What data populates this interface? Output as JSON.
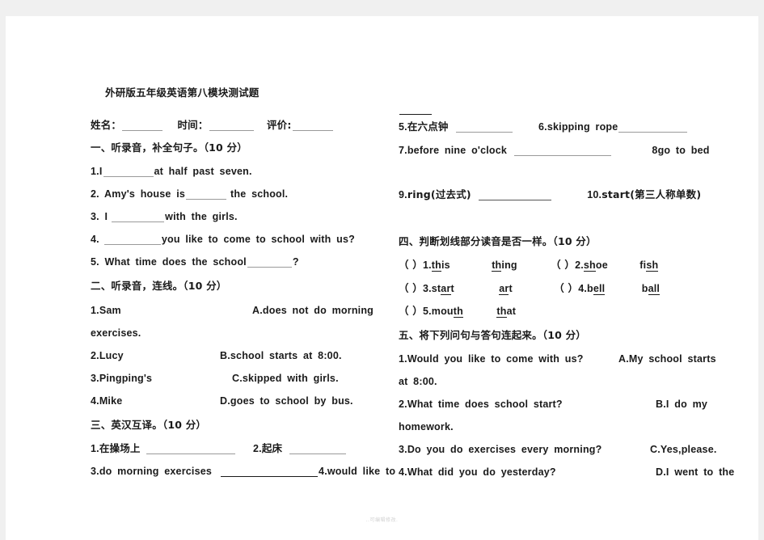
{
  "document": {
    "title": "外研版五年级英语第八模块测试题",
    "footer_note": "..可编辑修改."
  },
  "header": {
    "name_label": "姓名：",
    "time_label": "时间：",
    "score_label": "评价:"
  },
  "sections": {
    "one": {
      "heading": "一、听录音，补全句子。（10 分）",
      "items": [
        {
          "num": "1.I",
          "tail": "at half past seven."
        },
        {
          "num": "2. Amy's house is",
          "tail": "the school."
        },
        {
          "num": "3. I",
          "tail": "with the girls."
        },
        {
          "num": "4.",
          "tail": "you like to come to school with us?"
        },
        {
          "num": "5. What time does the school",
          "tail": "?"
        }
      ]
    },
    "two": {
      "heading": "二、听录音，连线。（10 分）",
      "left_items": [
        "1.Sam",
        "2.Lucy",
        "3.Pingping's",
        "4.Mike"
      ],
      "left_item_1_wrap": "exercises.",
      "right_items": [
        "A.does not do morning",
        "B.school starts at 8:00.",
        "C.skipped with girls.",
        "D.goes to school by bus."
      ]
    },
    "three": {
      "heading": "三、英汉互译。（10 分）",
      "items": [
        {
          "num": "1.",
          "text": "在操场上"
        },
        {
          "num": "2.",
          "text": "起床"
        },
        {
          "num": "3.",
          "text": "do morning exercises"
        },
        {
          "num": "4.",
          "text": "would like to"
        },
        {
          "num": "5.",
          "text": "在六点钟"
        },
        {
          "num": "6.",
          "text": "skipping rope"
        },
        {
          "num": "7.",
          "text": "before nine o'clock"
        },
        {
          "num": "8",
          "text": "go to bed"
        },
        {
          "num": "9.",
          "text": "ring(过去式)"
        },
        {
          "num": "10.",
          "text": "start(第三人称单数)"
        }
      ]
    },
    "four": {
      "heading": "四、判断划线部分读音是否一样。（10 分）",
      "items": [
        {
          "bracket": "（    ）",
          "num": "1.",
          "w1_pre": "",
          "w1_u": "th",
          "w1_post": "is",
          "w2_pre": "",
          "w2_u": "th",
          "w2_post": "ing"
        },
        {
          "bracket": "（    ）",
          "num": "2.",
          "w1_pre": "",
          "w1_u": "sh",
          "w1_post": "oe",
          "w2_pre": "fi",
          "w2_u": "sh ",
          "w2_post": ""
        },
        {
          "bracket": "（    ）",
          "num": "3.",
          "w1_pre": "st",
          "w1_u": "ar",
          "w1_post": "t",
          "w2_pre": "",
          "w2_u": "ar",
          "w2_post": "t"
        },
        {
          "bracket": "（    ）",
          "num": "4.",
          "w1_pre": "b",
          "w1_u": "ell",
          "w1_post": "",
          "w2_pre": "b",
          "w2_u": "all",
          "w2_post": ""
        },
        {
          "bracket": "（    ）",
          "num": "5.",
          "w1_pre": "mou",
          "w1_u": "th",
          "w1_post": "",
          "w2_pre": " ",
          "w2_u": "th",
          "w2_post": "at"
        }
      ]
    },
    "five": {
      "heading": "五、将下列问句与答句连起来。（10 分）",
      "questions": [
        "1.Would you like to come with us?",
        "2.What time does school start?",
        "3.Do you do exercises every morning?",
        "4.What did you do yesterday?"
      ],
      "answers": [
        {
          "head": "A.My school starts",
          "wrap": "at 8:00."
        },
        {
          "head": "B.I do my",
          "wrap": "homework."
        },
        {
          "head": "C.Yes,please.",
          "wrap": ""
        },
        {
          "head": "D.I went to the",
          "wrap": ""
        }
      ]
    }
  }
}
